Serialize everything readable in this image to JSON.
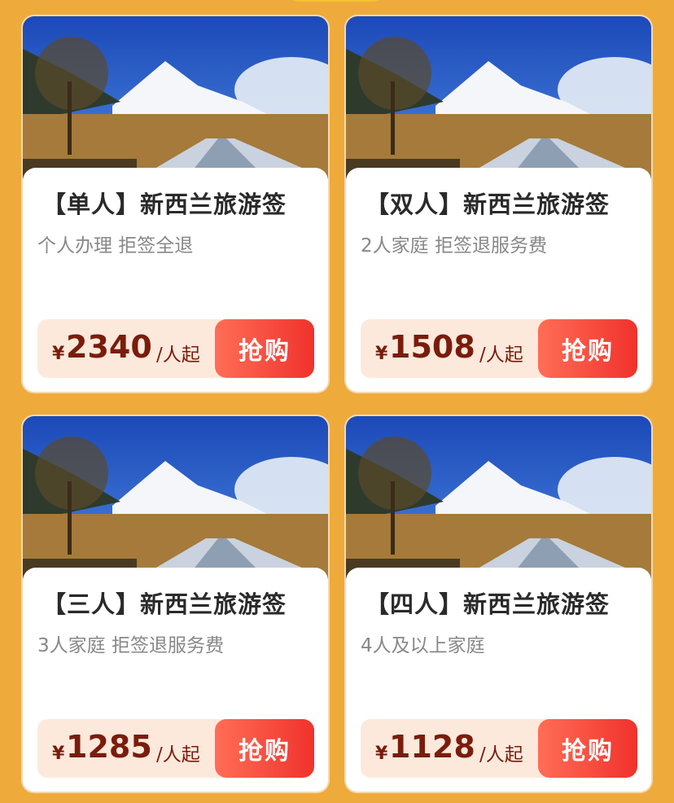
{
  "products": [
    {
      "title": "【单人】新西兰旅游签",
      "subtitle": "个人办理 拒签全退",
      "currency": "¥",
      "price": "2340",
      "unit": "/人起",
      "buy_label": "抢购"
    },
    {
      "title": "【双人】新西兰旅游签",
      "subtitle": "2人家庭 拒签退服务费",
      "currency": "¥",
      "price": "1508",
      "unit": "/人起",
      "buy_label": "抢购"
    },
    {
      "title": "【三人】新西兰旅游签",
      "subtitle": "3人家庭 拒签退服务费",
      "currency": "¥",
      "price": "1285",
      "unit": "/人起",
      "buy_label": "抢购"
    },
    {
      "title": "【四人】新西兰旅游签",
      "subtitle": "4人及以上家庭",
      "currency": "¥",
      "price": "1128",
      "unit": "/人起",
      "buy_label": "抢购"
    }
  ],
  "colors": {
    "background": "#eeab3b",
    "price_text": "#7a1c0c",
    "button": "#f0322c",
    "price_bar": "#fde9dc"
  }
}
